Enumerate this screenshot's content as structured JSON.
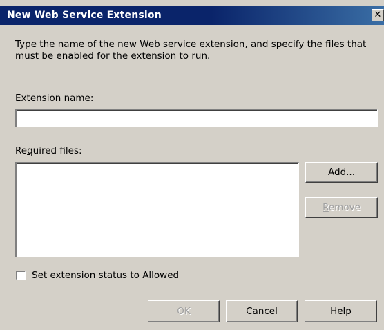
{
  "window": {
    "title": "New Web Service Extension",
    "close_glyph": "✕"
  },
  "intro_text": "Type the name of the new Web service extension, and specify the files that must be enabled for the extension to run.",
  "extension_name": {
    "label_prefix": "E",
    "label_accel": "x",
    "label_suffix": "tension name:",
    "value": ""
  },
  "required_files": {
    "label_prefix": "Re",
    "label_accel": "q",
    "label_suffix": "uired files:",
    "items": []
  },
  "buttons": {
    "add": {
      "prefix": "A",
      "accel": "d",
      "suffix": "d...",
      "enabled": true
    },
    "remove": {
      "prefix": "",
      "accel": "R",
      "suffix": "emove",
      "enabled": false
    },
    "ok": {
      "label": "OK",
      "enabled": false
    },
    "cancel": {
      "label": "Cancel",
      "enabled": true
    },
    "help": {
      "prefix": "",
      "accel": "H",
      "suffix": "elp",
      "enabled": true
    }
  },
  "status_checkbox": {
    "label_accel": "S",
    "label_suffix": "et extension status to Allowed",
    "checked": false
  },
  "colors": {
    "titlebar": "#0a246a",
    "dialog_bg": "#d4d0c8"
  }
}
